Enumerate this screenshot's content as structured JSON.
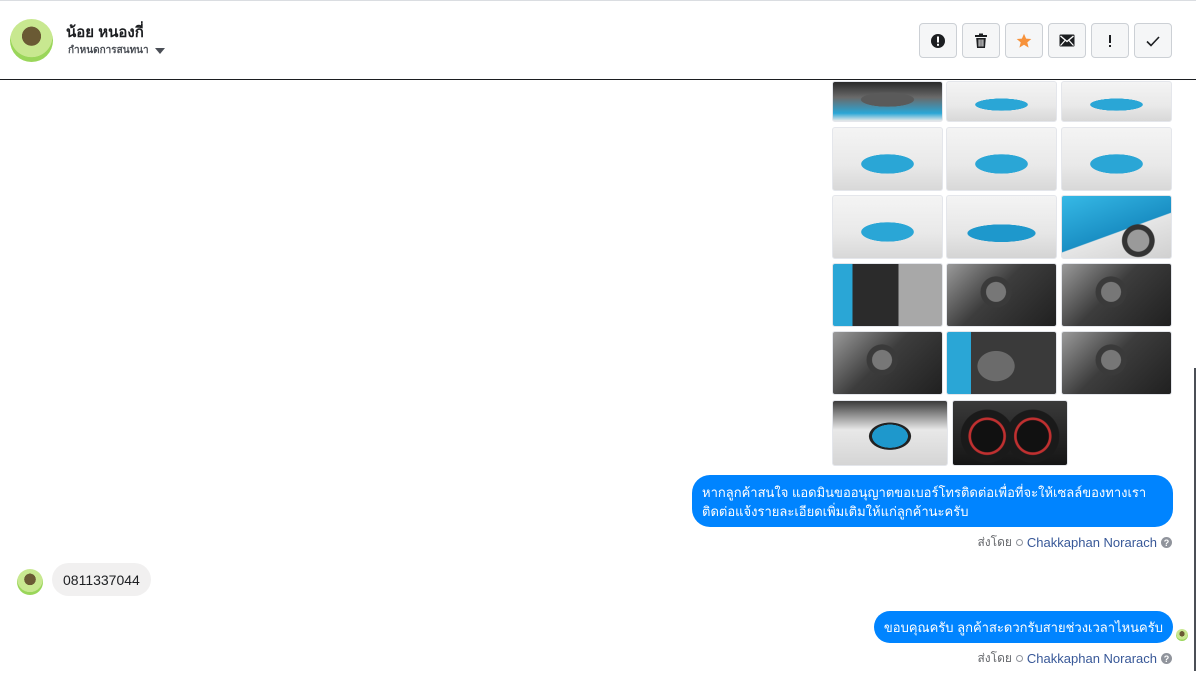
{
  "header": {
    "contact_name": "น้อย หนองกี่",
    "assign_label": "กำหนดการสนทนา"
  },
  "toolbar": {
    "buttons": [
      {
        "name": "spam-button",
        "icon": "alert-circle-icon"
      },
      {
        "name": "delete-button",
        "icon": "trash-icon"
      },
      {
        "name": "star-button",
        "icon": "star-icon"
      },
      {
        "name": "mark-unread-button",
        "icon": "envelope-icon"
      },
      {
        "name": "follow-up-button",
        "icon": "exclamation-icon"
      },
      {
        "name": "mark-done-button",
        "icon": "checkmark-icon"
      }
    ],
    "star_color": "#f7923b"
  },
  "thread": {
    "gallery_photos": [
      "engine-bay",
      "car-front-right",
      "car-front-left",
      "car-front",
      "car-rear-left",
      "car-rear",
      "car-rear-right",
      "car-side",
      "car-wheel-closeup",
      "door-interior",
      "dashboard",
      "gear-shift",
      "steering-wheel",
      "rear-seats",
      "cabin-interior",
      "open-trunk",
      "gauge-cluster"
    ],
    "messages": [
      {
        "direction": "outgoing",
        "text_line1": "หากลูกค้าสนใจ แอดมินขออนุญาตขอเบอร์โทรติดต่อเพื่อที่จะให้เซลล์ของทางเรา",
        "text_line2": "ติดต่อแจ้งรายละเอียดเพิ่มเติมให้แก่ลูกค้านะครับ",
        "sent_by_label": "ส่งโดย",
        "agent": "Chakkaphan Norarach"
      },
      {
        "direction": "incoming",
        "text": "0811337044"
      },
      {
        "direction": "outgoing",
        "text": "ขอบคุณครับ ลูกค้าสะดวกรับสายช่วงเวลาไหนครับ",
        "sent_by_label": "ส่งโดย",
        "agent": "Chakkaphan Norarach"
      }
    ],
    "bubble_color": "#0084ff",
    "help_glyph": "?"
  }
}
